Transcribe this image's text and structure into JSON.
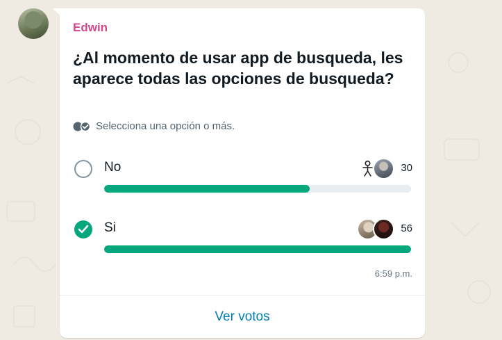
{
  "colors": {
    "background": "#efeae2",
    "bubble": "#ffffff",
    "sender_name": "#d1488d",
    "accent": "#06a77d",
    "link": "#027eb5"
  },
  "message": {
    "sender": "Edwin",
    "time": "6:59 p.m."
  },
  "poll": {
    "question": "¿Al momento de usar app de busqueda, les aparece todas las opciones de busqueda?",
    "hint": "Selecciona una opción o más.",
    "hint_icon": "double-check-icon",
    "options": [
      {
        "label": "No",
        "votes": "30",
        "selected": false,
        "fill_fraction": 0.67
      },
      {
        "label": "Si",
        "votes": "56",
        "selected": true,
        "fill_fraction": 1.0
      }
    ],
    "view_votes_label": "Ver votos"
  }
}
